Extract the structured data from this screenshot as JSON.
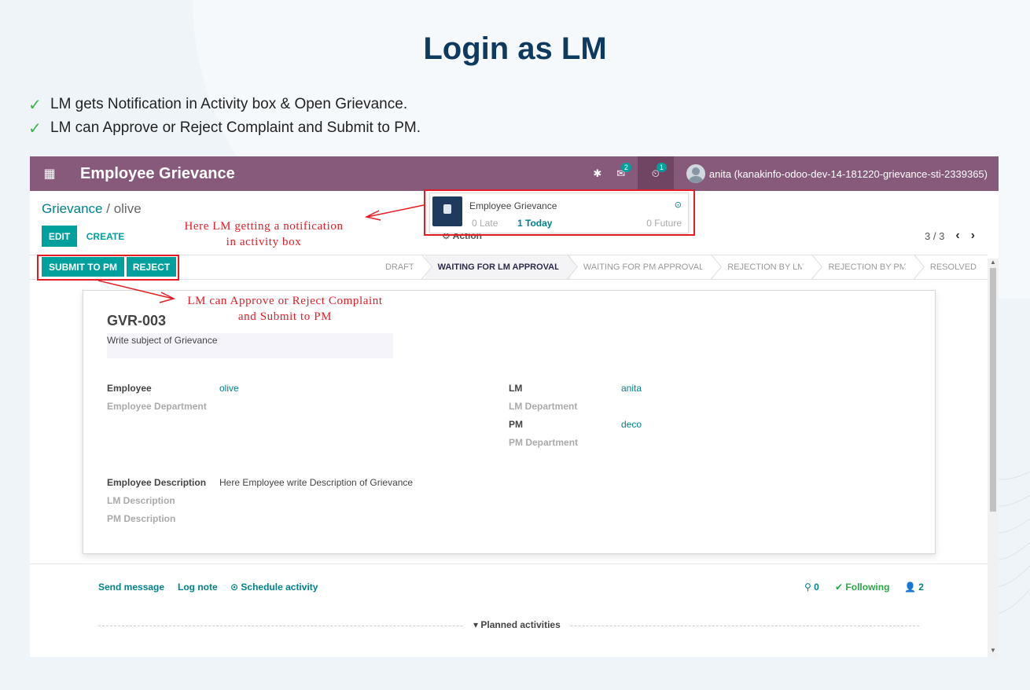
{
  "slide": {
    "title": "Login as LM",
    "bullets": [
      "LM gets Notification in Activity box & Open Grievance.",
      "LM can Approve or Reject Complaint and Submit to PM."
    ]
  },
  "navbar": {
    "app_title": "Employee Grievance",
    "messages_badge": "2",
    "activity_badge": "1",
    "user": "anita (kanakinfo-odoo-dev-14-181220-grievance-sti-2339365)",
    "color": "#875a7b"
  },
  "breadcrumb": {
    "parent": "Grievance",
    "separator": "/",
    "current": "olive"
  },
  "buttons": {
    "edit": "EDIT",
    "create": "CREATE",
    "action": "Action",
    "submit": "SUBMIT TO PM",
    "reject": "REJECT"
  },
  "pager": {
    "value": "3 / 3"
  },
  "stages": [
    "DRAFT",
    "WAITING FOR LM APPROVAL",
    "WAITING FOR PM APPROVAL",
    "REJECTION BY LM",
    "REJECTION BY PM",
    "RESOLVED"
  ],
  "active_stage": "WAITING FOR LM APPROVAL",
  "form": {
    "reference": "GVR-003",
    "subject_placeholder": "Write subject of Grievance",
    "employee_label": "Employee",
    "employee_value": "olive",
    "employee_dept_label": "Employee Department",
    "lm_label": "LM",
    "lm_value": "anita",
    "lm_dept_label": "LM Department",
    "pm_label": "PM",
    "pm_value": "deco",
    "pm_dept_label": "PM Department",
    "emp_desc_label": "Employee Description",
    "emp_desc_value": "Here Employee write Description of Grievance",
    "lm_desc_label": "LM Description",
    "pm_desc_label": "PM Description"
  },
  "chatter": {
    "send_message": "Send message",
    "log_note": "Log note",
    "schedule_activity": "Schedule activity",
    "attachments": "0",
    "following": "Following",
    "followers": "2",
    "planned": "Planned activities"
  },
  "notification": {
    "title": "Employee Grievance",
    "late": "0 Late",
    "today": "1 Today",
    "future": "0 Future"
  },
  "annotations": {
    "notification_note_line1": "Here LM getting a notification",
    "notification_note_line2": "in activity box",
    "approve_note_line1": "LM can Approve or Reject Complaint",
    "approve_note_line2": "and Submit to PM"
  },
  "colors": {
    "accent": "#00a09d",
    "brand": "#875a7b",
    "annotation": "#e31b23",
    "check": "#3bb44a"
  }
}
